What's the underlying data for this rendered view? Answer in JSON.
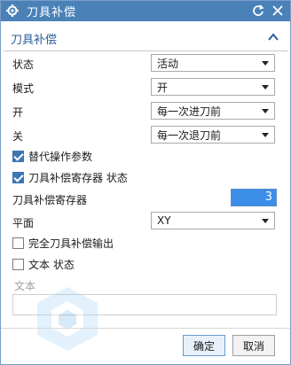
{
  "window": {
    "title": "刀具补偿"
  },
  "group": {
    "title": "刀具补偿"
  },
  "rows": {
    "status": {
      "label": "状态",
      "value": "活动"
    },
    "mode": {
      "label": "模式",
      "value": "开"
    },
    "on": {
      "label": "开",
      "value": "每一次进刀前"
    },
    "off": {
      "label": "关",
      "value": "每一次退刀前"
    },
    "plane": {
      "label": "平面",
      "value": "XY"
    }
  },
  "checks": {
    "alt_params": {
      "label": "替代操作参数",
      "checked": true
    },
    "comp_register_status": {
      "label": "刀具补偿寄存器 状态",
      "checked": true
    },
    "full_comp_output": {
      "label": "完全刀具补偿输出",
      "checked": false
    },
    "text_status": {
      "label": "文本 状态",
      "checked": false
    }
  },
  "register": {
    "label": "刀具补偿寄存器",
    "value": "3"
  },
  "text_section": {
    "label": "文本",
    "value": ""
  },
  "buttons": {
    "ok": "确定",
    "cancel": "取消"
  },
  "colors": {
    "titlebar": "#4a82b8",
    "accent": "#2a5d9a",
    "field_selected": "#3c8ee8"
  }
}
